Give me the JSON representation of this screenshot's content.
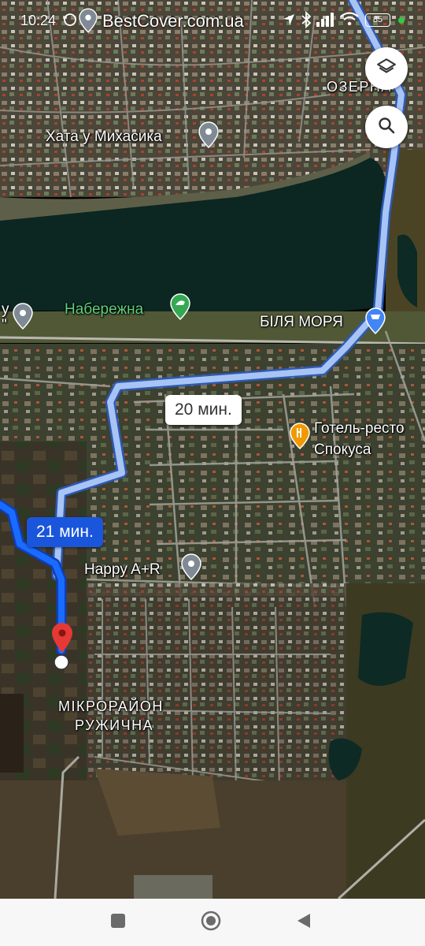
{
  "status_bar": {
    "time": "10:24",
    "watermark": "BestCover.com.ua",
    "battery": "85"
  },
  "map": {
    "places": [
      {
        "name": "Хата у Михасика",
        "kind": "place"
      },
      {
        "name": "Набережна",
        "kind": "park"
      },
      {
        "name": "БІЛЯ МОРЯ",
        "kind": "shop"
      },
      {
        "name": "Готель-ресто",
        "kind": "restaurant"
      },
      {
        "name": "Спокуса",
        "kind": "restaurant"
      },
      {
        "name": "Happy A+R",
        "kind": "place"
      }
    ],
    "areas": [
      {
        "name": "ОЗЕРНА"
      },
      {
        "name": "МІКРОРАЙОН"
      },
      {
        "name": "РУЖИЧНА"
      }
    ],
    "clipped_labels": {
      "left_top": "у",
      "left_bottom": "\""
    },
    "routes": {
      "alternative": {
        "time": "20 мин."
      },
      "main": {
        "time": "21 мин."
      }
    },
    "colors": {
      "route_main": "#1a56db",
      "route_alt": "#a7c4f5",
      "destination_pin": "#e53935",
      "water": "#0c2622"
    }
  },
  "buttons": {
    "layers_icon": "layers-icon",
    "search_icon": "search-icon"
  },
  "nav": {
    "recents_icon": "square-icon",
    "home_icon": "circle-icon",
    "back_icon": "triangle-back-icon"
  }
}
